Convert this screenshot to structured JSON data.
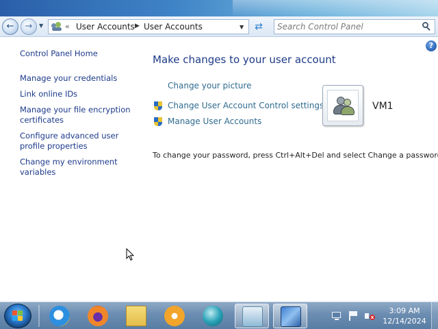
{
  "address_bar": {
    "breadcrumb_prefix": "«",
    "breadcrumb": [
      "User Accounts",
      "User Accounts"
    ],
    "search_placeholder": "Search Control Panel"
  },
  "left_pane": {
    "home_link": "Control Panel Home",
    "links": [
      "Manage your credentials",
      "Link online IDs",
      "Manage your file encryption certificates",
      "Configure advanced user profile properties",
      "Change my environment variables"
    ]
  },
  "main": {
    "title": "Make changes to your user account",
    "tasks": [
      {
        "label": "Change your picture",
        "icon": null
      },
      {
        "label": "Change User Account Control settings",
        "icon": "uac-shield-icon"
      },
      {
        "label": "Manage User Accounts",
        "icon": "uac-shield-icon"
      }
    ],
    "user_name": "VM1",
    "password_note": "To change your password, press Ctrl+Alt+Del and select Change a password."
  },
  "taskbar": {
    "apps": [
      {
        "name": "internet-explorer-icon"
      },
      {
        "name": "firefox-icon"
      },
      {
        "name": "file-explorer-icon"
      },
      {
        "name": "media-player-icon"
      },
      {
        "name": "globe-app-icon"
      },
      {
        "name": "control-panel-icon",
        "active": true
      },
      {
        "name": "remote-desktop-icon",
        "active": true
      }
    ],
    "tray": [
      "network-icon",
      "action-center-flag-icon",
      "volume-muted-icon"
    ],
    "clock_time": "3:09 AM",
    "clock_date": "12/14/2024"
  },
  "colors": {
    "link": "#1c3a8a",
    "task_link": "#2f6b8f",
    "title": "#1d3a86"
  }
}
